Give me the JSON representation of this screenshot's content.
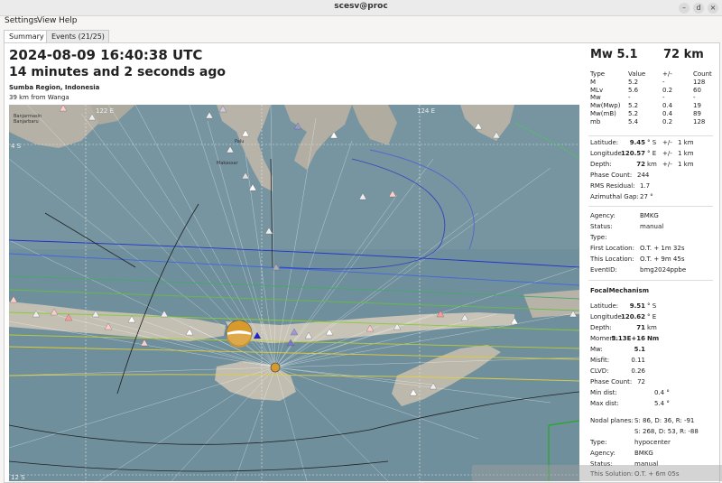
{
  "window": {
    "title": "scesv@proc",
    "btn_min": "–",
    "btn_max": "d",
    "btn_close": "×"
  },
  "menu": {
    "settings": "Settings",
    "view": "View",
    "help": "Help"
  },
  "tabs": [
    {
      "label": "Summary"
    },
    {
      "label": "Events (21/25)"
    }
  ],
  "header": {
    "time": "2024-08-09 16:40:38 UTC",
    "ago": "14 minutes and 2 seconds ago",
    "region": "Sumba Region, Indonesia",
    "distance": "39 km from Wanga"
  },
  "map": {
    "grid_labels": {
      "lon_122": "122 E",
      "lon_124": "124 E",
      "lat_4": "4 S",
      "lat_12": "12 S"
    },
    "place_labels": {
      "banjarmasin": "Banjarmasin",
      "banjarbaru": "Banjarbaru",
      "palu": "Palu",
      "makassar": "Makassar"
    },
    "colors": {
      "sea": "#6f8f9c",
      "land": "#b7b3a9",
      "ray": "#ffffff",
      "epicenter": "#d89a2a"
    }
  },
  "summary": {
    "magnitude": "Mw  5.1",
    "depth": "72 km",
    "mag_table": {
      "headers": [
        "Type",
        "Value",
        "+/-",
        "Count"
      ],
      "rows": [
        [
          "M",
          "5.2",
          "-",
          "128"
        ],
        [
          "MLv",
          "5.6",
          "0.2",
          "60"
        ],
        [
          "Mw",
          "-",
          "-",
          "-"
        ],
        [
          "Mw(Mwp)",
          "5.2",
          "0.4",
          "19"
        ],
        [
          "Mw(mB)",
          "5.2",
          "0.4",
          "89"
        ],
        [
          "mb",
          "5.4",
          "0.2",
          "128"
        ]
      ]
    },
    "origin": {
      "lat_label": "Latitude:",
      "lat_val": "9.45",
      "lat_unit": "° S",
      "lat_pm": "+/-",
      "lat_err": "1 km",
      "lon_label": "Longitude:",
      "lon_val": "120.57",
      "lon_unit": "° E",
      "lon_pm": "+/-",
      "lon_err": "1 km",
      "depth_label": "Depth:",
      "depth_val": "72",
      "depth_unit": "km",
      "depth_pm": "+/-",
      "depth_err": "1 km",
      "phase_label": "Phase Count:",
      "phase_val": "244",
      "rms_label": "RMS Residual:",
      "rms_val": "1.7",
      "gap_label": "Azimuthal Gap:",
      "gap_val": "27 °"
    },
    "info": {
      "agency_label": "Agency:",
      "agency_val": "BMKG",
      "status_label": "Status:",
      "status_val": "manual",
      "type_label": "Type:",
      "type_val": "",
      "first_label": "First Location:",
      "first_val": "O.T. + 1m 32s",
      "this_label": "This Location:",
      "this_val": "O.T. + 9m 45s",
      "eventid_label": "EventID:",
      "eventid_val": "bmg2024ppbe"
    },
    "fm": {
      "title": "FocalMechanism",
      "lat_label": "Latitude:",
      "lat_val": "9.51",
      "lat_unit": "° S",
      "lon_label": "Longitude:",
      "lon_val": "120.62",
      "lon_unit": "° E",
      "depth_label": "Depth:",
      "depth_val": "71",
      "depth_unit": "km",
      "moment_label": "Moment:",
      "moment_val": "5.13E+16",
      "moment_unit": "Nm",
      "mw_label": "Mw:",
      "mw_val": "5.1",
      "misfit_label": "Misfit:",
      "misfit_val": "0.11",
      "clvd_label": "CLVD:",
      "clvd_val": "0.26",
      "phase_label": "Phase Count:",
      "phase_val": "72",
      "mind_label": "Min dist:",
      "mind_val": "0.4 °",
      "maxd_label": "Max dist:",
      "maxd_val": "5.4 °",
      "np_label": "Nodal planes:",
      "np1": "S: 86, D: 36, R: -91",
      "np2": "S: 268, D: 53, R: -88",
      "type_label": "Type:",
      "type_val": "hypocenter",
      "agency_label": "Agency:",
      "agency_val": "BMKG",
      "status_label": "Status:",
      "status_val": "manual",
      "sol_label": "This Solution:",
      "sol_val": "O.T. + 6m 05s"
    }
  }
}
